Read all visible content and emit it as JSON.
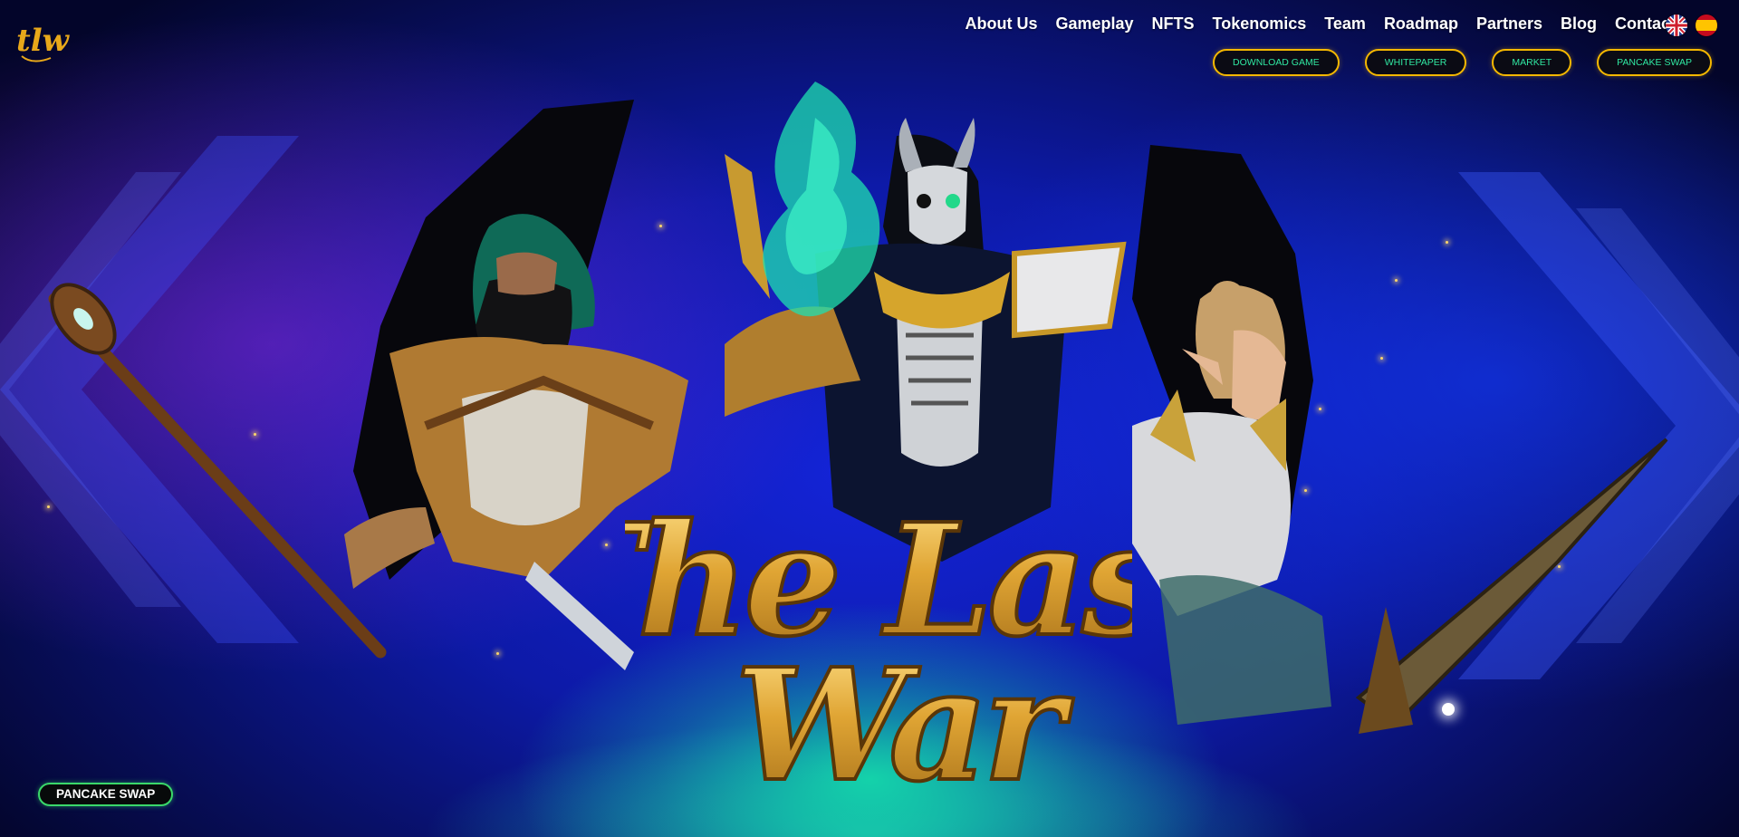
{
  "brand": {
    "logo_text": "tlw"
  },
  "nav": {
    "links": [
      {
        "label": "About Us"
      },
      {
        "label": "Gameplay"
      },
      {
        "label": "NFTS"
      },
      {
        "label": "Tokenomics"
      },
      {
        "label": "Team"
      },
      {
        "label": "Roadmap"
      },
      {
        "label": "Partners"
      },
      {
        "label": "Blog"
      },
      {
        "label": "Contact"
      }
    ],
    "languages": [
      "english-flag-icon",
      "spanish-flag-icon"
    ]
  },
  "actions": {
    "buttons": [
      {
        "label": "DOWNLOAD GAME"
      },
      {
        "label": "WHITEPAPER"
      },
      {
        "label": "MARKET"
      },
      {
        "label": "PANCAKE SWAP"
      }
    ]
  },
  "hero": {
    "title_line1": "The Last",
    "title_line2": "War"
  },
  "floating_button": {
    "label": "PANCAKE SWAP"
  },
  "colors": {
    "accent_gold": "#f5b800",
    "accent_green": "#30e8a2",
    "background_blue": "#1424d8"
  }
}
